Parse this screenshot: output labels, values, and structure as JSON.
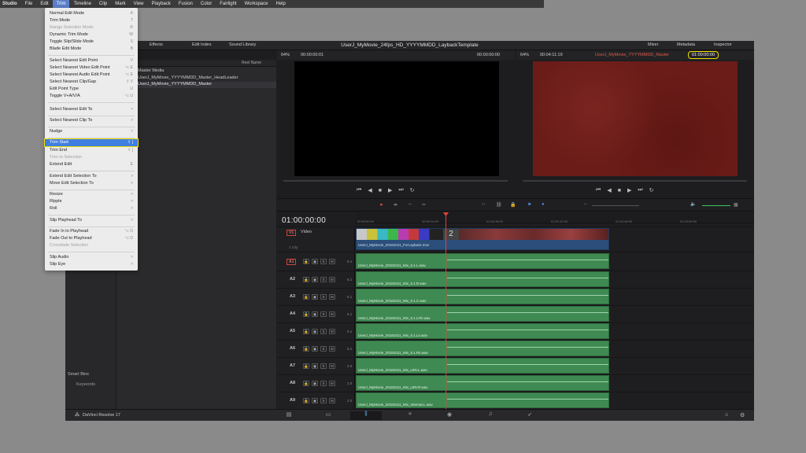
{
  "menubar": {
    "app": "Studio",
    "items": [
      "File",
      "Edit",
      "Trim",
      "Timeline",
      "Clip",
      "Mark",
      "View",
      "Playback",
      "Fusion",
      "Color",
      "Fairlight",
      "Workspace",
      "Help"
    ],
    "active": "Trim"
  },
  "trim_menu": {
    "items": [
      {
        "label": "Normal Edit Mode",
        "shortcut": "A"
      },
      {
        "label": "Trim Mode",
        "shortcut": "T"
      },
      {
        "label": "Range Selection Mode",
        "shortcut": "R",
        "disabled": true
      },
      {
        "label": "Dynamic Trim Mode",
        "shortcut": "W"
      },
      {
        "label": "Toggle Slip/Slide Mode",
        "shortcut": "S"
      },
      {
        "label": "Blade Edit Mode",
        "shortcut": "B"
      },
      {
        "label": "Select Nearest Edit Point",
        "shortcut": "V"
      },
      {
        "label": "Select Nearest Video Edit Point",
        "shortcut": "⌥ E"
      },
      {
        "label": "Select Nearest Audio Edit Point",
        "shortcut": "⌥ E"
      },
      {
        "label": "Select Nearest Clip/Gap",
        "shortcut": "⇧ V"
      },
      {
        "label": "Edit Point Type",
        "shortcut": "U"
      },
      {
        "label": "Toggle V+A/V/A",
        "shortcut": "⌥ U"
      },
      {
        "label": "Select Nearest Edit To",
        "shortcut": ">"
      },
      {
        "label": "Select Nearest Clip To",
        "shortcut": ">"
      },
      {
        "label": "Nudge",
        "shortcut": ">"
      },
      {
        "label": "Trim Start",
        "shortcut": "⇧ [",
        "highlighted": true
      },
      {
        "label": "Trim End",
        "shortcut": "⇧ ]"
      },
      {
        "label": "Trim to Selection",
        "shortcut": "",
        "disabled": true
      },
      {
        "label": "Extend Edit",
        "shortcut": "E"
      },
      {
        "label": "Extend Edit Selection To",
        "shortcut": ">"
      },
      {
        "label": "Move Edit Selection To",
        "shortcut": ">"
      },
      {
        "label": "Resize",
        "shortcut": ">"
      },
      {
        "label": "Ripple",
        "shortcut": ">"
      },
      {
        "label": "Roll",
        "shortcut": ">"
      },
      {
        "label": "Slip Playhead To",
        "shortcut": ">"
      },
      {
        "label": "Fade In to Playhead",
        "shortcut": "⌥ D"
      },
      {
        "label": "Fade Out to Playhead",
        "shortcut": "⌥ D"
      },
      {
        "label": "Crossfade Selection",
        "shortcut": "",
        "disabled": true
      },
      {
        "label": "Slip Audio",
        "shortcut": ">"
      },
      {
        "label": "Slip Eye",
        "shortcut": ">"
      }
    ]
  },
  "topbar": {
    "effects": "Effects",
    "edit_index": "Edit Index",
    "sound_library": "Sound Library",
    "project_title": "UserJ_MyMovie_24fps_HD_YYYYMMDD_LaybackTemplate",
    "mixer": "Mixer",
    "metadata": "Metadata",
    "inspector": "Inspector"
  },
  "source_viewer": {
    "zoom": "64%",
    "tc_left": "00:00:00:01",
    "tc_right": "00:00:00:00"
  },
  "record_viewer": {
    "zoom": "64%",
    "duration": "00:04:11:19",
    "timeline_name": "UserJ_MyMovie_YYYYMMDD_Master",
    "timecode": "01:00:00:00"
  },
  "media_pool": {
    "col_header": "Reel Name",
    "root": "Master Media",
    "items": [
      "UserJ_MyMovie_YYYYMMDD_Master_HeadLeader",
      "UserJ_MyMovie_YYYYMMDD_Master"
    ]
  },
  "bins": {
    "smart_bins": "Smart Bins",
    "keywords": "Keywords"
  },
  "timeline": {
    "timecode": "01:00:00:00",
    "ruler_ticks": [
      "00:59:59:00",
      "00:59:34:00",
      "01:00:38:00",
      "01:01:42:00",
      "01:02:46:00",
      "01:03:50:00"
    ],
    "video_track": {
      "id": "V1",
      "name": "Video",
      "clip_count": "1 Clip",
      "clip_name": "UserJ_MyMovie_20181011_ForLayback.mov"
    },
    "audio_tracks": [
      {
        "id": "A1",
        "ch": "5.1",
        "clip": "UserJ_MyMovie_20181011_Mix_5.1.L.wav"
      },
      {
        "id": "A2",
        "ch": "5.1",
        "clip": "UserJ_MyMovie_20181011_Mix_5.1.R.wav"
      },
      {
        "id": "A3",
        "ch": "5.1",
        "clip": "UserJ_MyMovie_20181011_Mix_5.1.C.wav"
      },
      {
        "id": "A4",
        "ch": "5.1",
        "clip": "UserJ_MyMovie_20181011_Mix_5.1.LFE.wav"
      },
      {
        "id": "A5",
        "ch": "5.1",
        "clip": "UserJ_MyMovie_20181011_Mix_5.1.Ls.wav"
      },
      {
        "id": "A6",
        "ch": "5.1",
        "clip": "UserJ_MyMovie_20181011_Mix_5.1.Rs.wav"
      },
      {
        "id": "A7",
        "ch": "2.0",
        "clip": "UserJ_MyMovie_20181011_Mix_LtRt.L.wav"
      },
      {
        "id": "A8",
        "ch": "2.0",
        "clip": "UserJ_MyMovie_20181011_Mix_LtRt.R.wav"
      },
      {
        "id": "A9",
        "ch": "2.0",
        "clip": "UserJ_MyMovie_20181011_Mix_Internat.L.wav"
      }
    ]
  },
  "bottombar": {
    "app_name": "DaVinci Resolve 17"
  }
}
